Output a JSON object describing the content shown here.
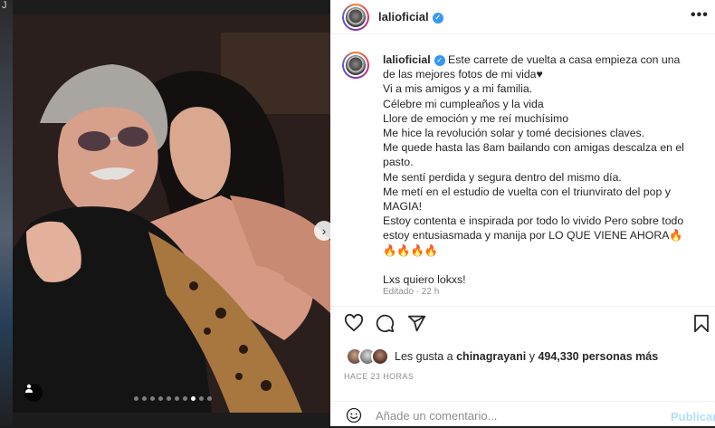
{
  "background": {
    "text": "J"
  },
  "post": {
    "photo_description_icon": "photo",
    "carousel": {
      "dots": 10,
      "active_index": 7
    }
  },
  "header": {
    "username": "lalioficial",
    "more_icon": "more-horizontal-icon"
  },
  "caption": {
    "author": "lalioficial",
    "lines": [
      "Este carrete de vuelta a casa empieza con una de las mejores fotos de mi vida♥︎",
      "Vi a mis amigos y a mi familia.",
      "Célebre mi cumpleaños y la vida",
      "Llore de emoción y me reí muchísimo",
      "Me hice la revolución solar y tomé decisiones claves.",
      "Me quede hasta las 8am bailando con amigas descalza en el pasto.",
      "Me sentí perdida y segura dentro del mismo día.",
      "Me metí en el estudio de vuelta con el triunvirato del pop y MAGIA!",
      "Estoy contenta e inspirada por todo lo vivido Pero sobre todo estoy entusiasmada y manija por LO QUE VIENE AHORA🔥🔥🔥🔥🔥",
      "",
      "Lxs quiero lokxs!"
    ],
    "edited": "Editado · 22 h"
  },
  "likes": {
    "prefix": "Les gusta a ",
    "user": "chinagrayani",
    "middle": " y ",
    "count": "494,330 personas más"
  },
  "time_ago": "HACE 23 HORAS",
  "comment": {
    "placeholder": "Añade un comentario...",
    "publish_label": "Publicar"
  },
  "colors": {
    "accent": "#3897f0",
    "publish_disabled": "#b2dffc",
    "muted": "#8e8e8e"
  }
}
